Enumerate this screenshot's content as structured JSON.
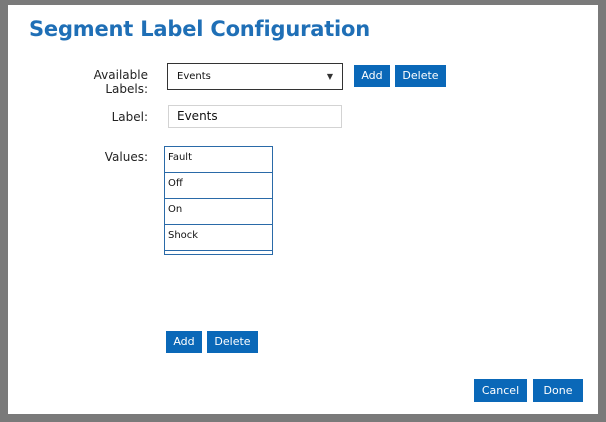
{
  "dialog": {
    "title": "Segment Label Configuration"
  },
  "available_labels": {
    "label": "Available Labels:",
    "selected": "Events",
    "add_label": "Add",
    "delete_label": "Delete"
  },
  "label_field": {
    "label": "Label:",
    "value": "Events"
  },
  "values": {
    "label": "Values:",
    "items": [
      "Fault",
      "Off",
      "On",
      "Shock"
    ],
    "add_label": "Add",
    "delete_label": "Delete"
  },
  "footer": {
    "cancel_label": "Cancel",
    "done_label": "Done"
  },
  "colors": {
    "accent": "#0a68b8",
    "title": "#1f6fb6"
  },
  "icons": {
    "dropdown": "triangle-down-icon"
  }
}
